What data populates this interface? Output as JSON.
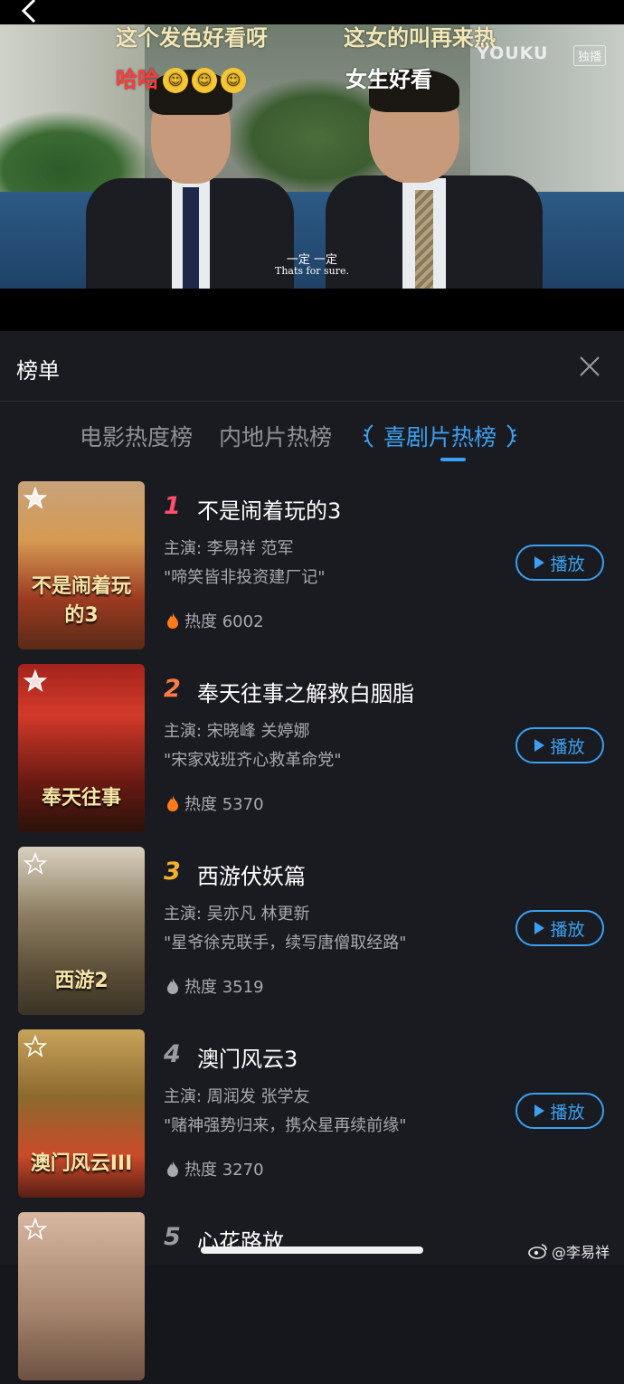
{
  "video": {
    "danmaku": [
      "这个发色好看呀",
      "这女的叫再来热",
      "哈哈",
      "女生好看"
    ],
    "emoji_glyph": "☺",
    "brand": "YOUKU",
    "brand_badge": "独播",
    "subtitle_cn": "一定 一定",
    "subtitle_en": "Thats for sure."
  },
  "sheet": {
    "title": "榜单",
    "tabs": [
      "电影热度榜",
      "内地片热榜",
      "喜剧片热榜"
    ],
    "active_tab": 2,
    "accent_color": "#3aa0f2"
  },
  "items": [
    {
      "rank": "1",
      "rank_color": "#ff4d6d",
      "title": "不是闹着玩的3",
      "cast": "主演: 李易祥 范军",
      "tagline": "\"啼笑皆非投资建厂记\"",
      "heat": "热度 6002",
      "hot": true,
      "play": "播放",
      "poster_text": "不是闹着玩的3"
    },
    {
      "rank": "2",
      "rank_color": "#ff7a45",
      "title": "奉天往事之解救白胭脂",
      "cast": "主演: 宋晓峰 关婷娜",
      "tagline": "\"宋家戏班齐心救革命党\"",
      "heat": "热度 5370",
      "hot": true,
      "play": "播放",
      "poster_text": "奉天往事"
    },
    {
      "rank": "3",
      "rank_color": "#f5b02e",
      "title": "西游伏妖篇",
      "cast": "主演: 吴亦凡 林更新",
      "tagline": "\"星爷徐克联手，续写唐僧取经路\"",
      "heat": "热度 3519",
      "hot": false,
      "play": "播放",
      "poster_text": "西游2"
    },
    {
      "rank": "4",
      "rank_color": "#9a9ca2",
      "title": "澳门风云3",
      "cast": "主演: 周润发 张学友",
      "tagline": "\"赌神强势归来，携众星再续前缘\"",
      "heat": "热度 3270",
      "hot": false,
      "play": "播放",
      "poster_text": "澳门风云III"
    },
    {
      "rank": "5",
      "rank_color": "#9a9ca2",
      "title": "心花路放",
      "cast": "",
      "tagline": "",
      "heat": "",
      "hot": false,
      "play": "",
      "poster_text": ""
    }
  ],
  "watermark": "@李易祥"
}
